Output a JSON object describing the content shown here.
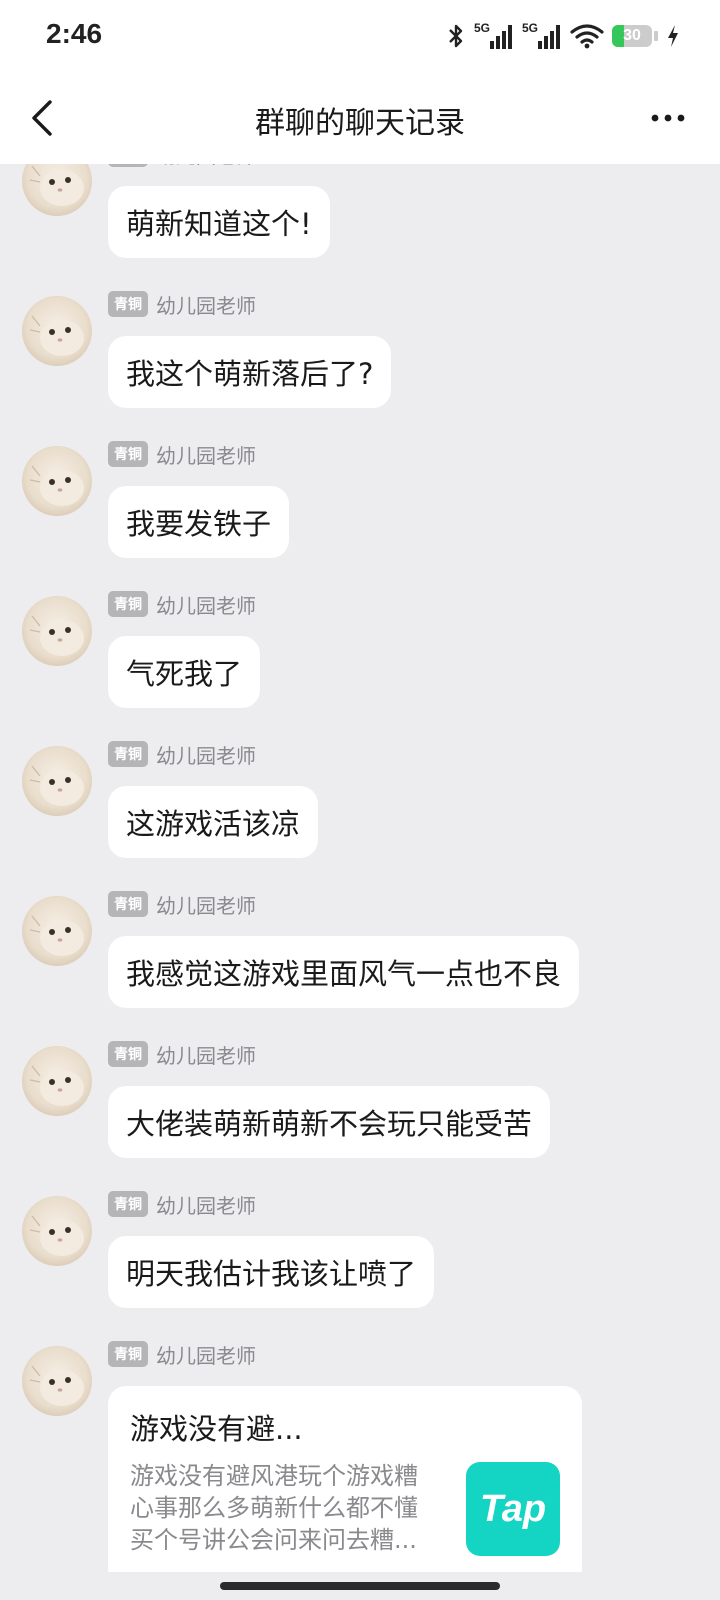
{
  "status_bar": {
    "time": "2:46",
    "battery_level": "30",
    "battery_fraction": 0.3,
    "network_label": "5G",
    "icons": [
      "bluetooth-icon",
      "signal-5g-icon",
      "signal-5g-icon",
      "wifi-icon",
      "battery-icon",
      "charging-icon"
    ]
  },
  "header": {
    "title": "群聊的聊天记录",
    "back_icon": "chevron-left-icon",
    "more_icon": "more-dots-icon"
  },
  "messages": [
    {
      "badge": "青铜",
      "sender": "幼儿园老师",
      "text": "萌新知道这个!"
    },
    {
      "badge": "青铜",
      "sender": "幼儿园老师",
      "text": "我这个萌新落后了?"
    },
    {
      "badge": "青铜",
      "sender": "幼儿园老师",
      "text": "我要发铁子"
    },
    {
      "badge": "青铜",
      "sender": "幼儿园老师",
      "text": "气死我了"
    },
    {
      "badge": "青铜",
      "sender": "幼儿园老师",
      "text": "这游戏活该凉"
    },
    {
      "badge": "青铜",
      "sender": "幼儿园老师",
      "text": "我感觉这游戏里面风气一点也不良"
    },
    {
      "badge": "青铜",
      "sender": "幼儿园老师",
      "text": "大佬装萌新萌新不会玩只能受苦"
    },
    {
      "badge": "青铜",
      "sender": "幼儿园老师",
      "text": "明天我估计我该让喷了"
    },
    {
      "badge": "青铜",
      "sender": "幼儿园老师",
      "card": {
        "title": "游戏没有避...",
        "desc": "游戏没有避风港玩个游戏糟心事那么多萌新什么都不懂买个号讲公会问来问去糟...",
        "logo": "Tap"
      }
    }
  ],
  "colors": {
    "background": "#ededf0",
    "bubble": "#ffffff",
    "badge": "#b5b5b8",
    "tap_brand": "#14d5c4",
    "battery_green": "#35c759"
  }
}
